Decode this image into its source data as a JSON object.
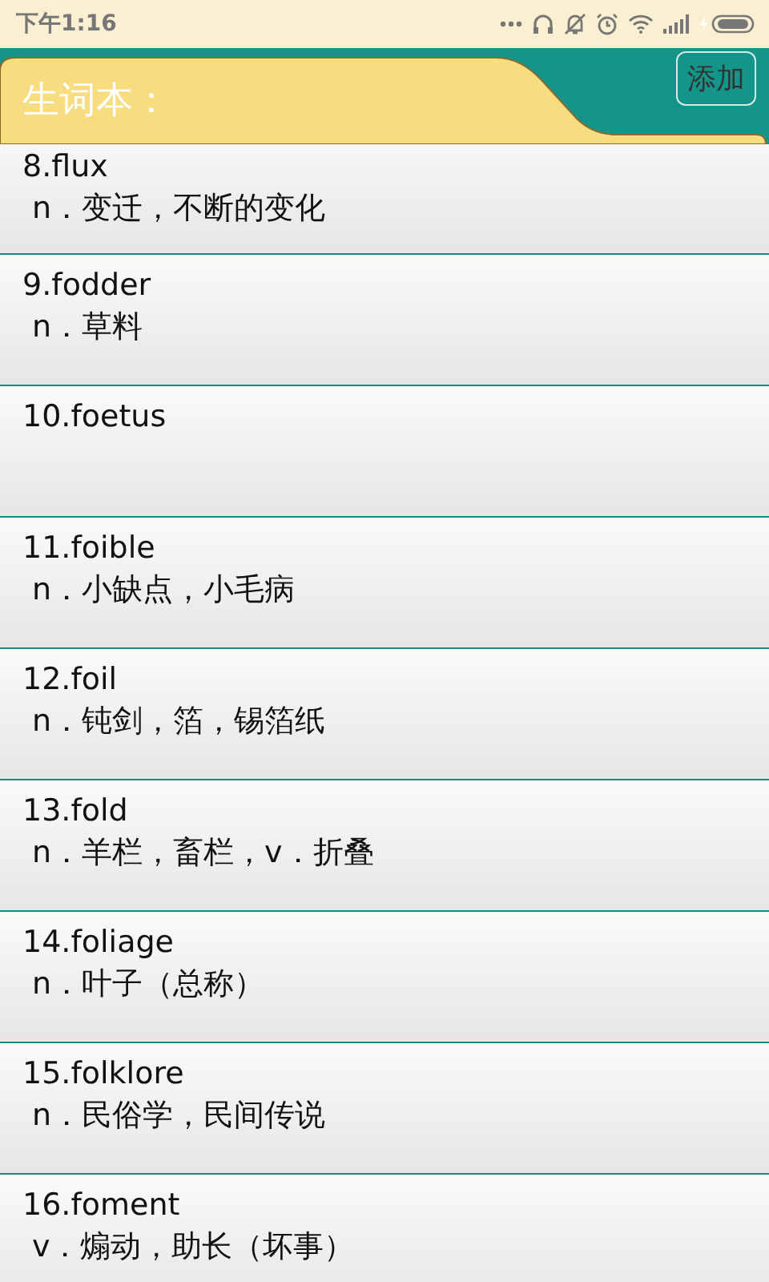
{
  "status_bar": {
    "time": "下午1:16"
  },
  "header": {
    "title": "生词本：",
    "add_button": "添加"
  },
  "words": [
    {
      "word": "8.flux",
      "meaning": "n．变迁，不断的变化"
    },
    {
      "word": "9.fodder",
      "meaning": "n．草料"
    },
    {
      "word": "10.foetus"
    },
    {
      "word": "11.foible",
      "meaning": "n．小缺点，小毛病"
    },
    {
      "word": "12.foil",
      "meaning": "n．钝剑，箔，锡箔纸"
    },
    {
      "word": "13.fold",
      "meaning": "n．羊栏，畜栏，v．折叠"
    },
    {
      "word": "14.foliage",
      "meaning": "n．叶子（总称）"
    },
    {
      "word": "15.folklore",
      "meaning": "n．民俗学，民间传说"
    },
    {
      "word": "16.foment",
      "meaning": "v．煽动，助长（坏事）"
    }
  ]
}
